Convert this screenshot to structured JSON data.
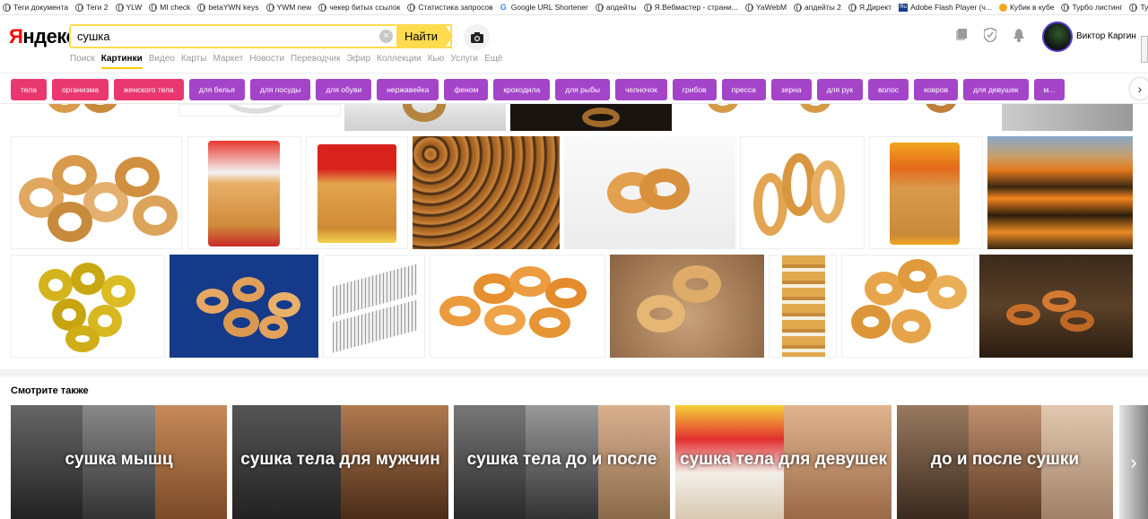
{
  "bookmarks": [
    {
      "icon": "globe-icon",
      "label": "Теги документа"
    },
    {
      "icon": "globe-icon",
      "label": "Теги 2"
    },
    {
      "icon": "globe-icon",
      "label": "YLW"
    },
    {
      "icon": "globe-icon",
      "label": "MI check"
    },
    {
      "icon": "globe-icon",
      "label": "betaYWN keys"
    },
    {
      "icon": "globe-icon",
      "label": "YWM new"
    },
    {
      "icon": "globe-icon",
      "label": "чекер битых ссылок"
    },
    {
      "icon": "globe-icon",
      "label": "Статистика запросов"
    },
    {
      "icon": "google-icon",
      "label": "Google URL Shortener"
    },
    {
      "icon": "globe-icon",
      "label": "апдейты"
    },
    {
      "icon": "globe-icon",
      "label": "Я.Вебмастер - страни..."
    },
    {
      "icon": "globe-icon",
      "label": "YaWebM"
    },
    {
      "icon": "globe-icon",
      "label": "апдейты 2"
    },
    {
      "icon": "globe-icon",
      "label": "Я.Директ"
    },
    {
      "icon": "ru-icon",
      "label": "Adobe Flash Player (ч..."
    },
    {
      "icon": "cube-icon",
      "label": "Кубик в кубе"
    },
    {
      "icon": "globe-icon",
      "label": "Турбо листинг"
    },
    {
      "icon": "globe-icon",
      "label": "Турбо"
    }
  ],
  "header": {
    "logo_first": "Я",
    "logo_rest": "ндекс",
    "search_value": "сушка",
    "clear_symbol": "×",
    "find_label": "Найти",
    "user_name": "Виктор Каргин"
  },
  "nav": {
    "items": [
      "Поиск",
      "Картинки",
      "Видео",
      "Карты",
      "Маркет",
      "Новости",
      "Переводчик",
      "Эфир",
      "Коллекции",
      "Кью",
      "Услуги",
      "Ещё"
    ],
    "active": "Картинки"
  },
  "chips": [
    {
      "label": "тела",
      "color": "#e9386f"
    },
    {
      "label": "организма",
      "color": "#e9386f"
    },
    {
      "label": "женского тела",
      "color": "#e9386f"
    },
    {
      "label": "для белья",
      "color": "#a445c9"
    },
    {
      "label": "для посуды",
      "color": "#a445c9"
    },
    {
      "label": "для обуви",
      "color": "#a445c9"
    },
    {
      "label": "нержавейка",
      "color": "#a445c9"
    },
    {
      "label": "феном",
      "color": "#a445c9"
    },
    {
      "label": "крокодила",
      "color": "#a445c9"
    },
    {
      "label": "для рыбы",
      "color": "#a445c9"
    },
    {
      "label": "челночок",
      "color": "#a445c9"
    },
    {
      "label": "грибов",
      "color": "#a445c9"
    },
    {
      "label": "пресса",
      "color": "#a445c9"
    },
    {
      "label": "зерна",
      "color": "#a445c9"
    },
    {
      "label": "для рук",
      "color": "#a445c9"
    },
    {
      "label": "волос",
      "color": "#a445c9"
    },
    {
      "label": "ковров",
      "color": "#a445c9"
    },
    {
      "label": "для девушек",
      "color": "#a445c9"
    },
    {
      "label": "м...",
      "color": "#a445c9"
    }
  ],
  "see_also": {
    "title": "Смотрите также",
    "cards": [
      "сушка мышц",
      "сушка тела для мужчин",
      "сушка тела до и после",
      "сушка тела для девушек",
      "до и после сушки"
    ],
    "next_symbol": "›"
  },
  "colors": {
    "accent": "#ffdb4d",
    "chip_pink": "#e9386f",
    "chip_purple": "#a445c9",
    "logo_red": "#ff0000"
  }
}
